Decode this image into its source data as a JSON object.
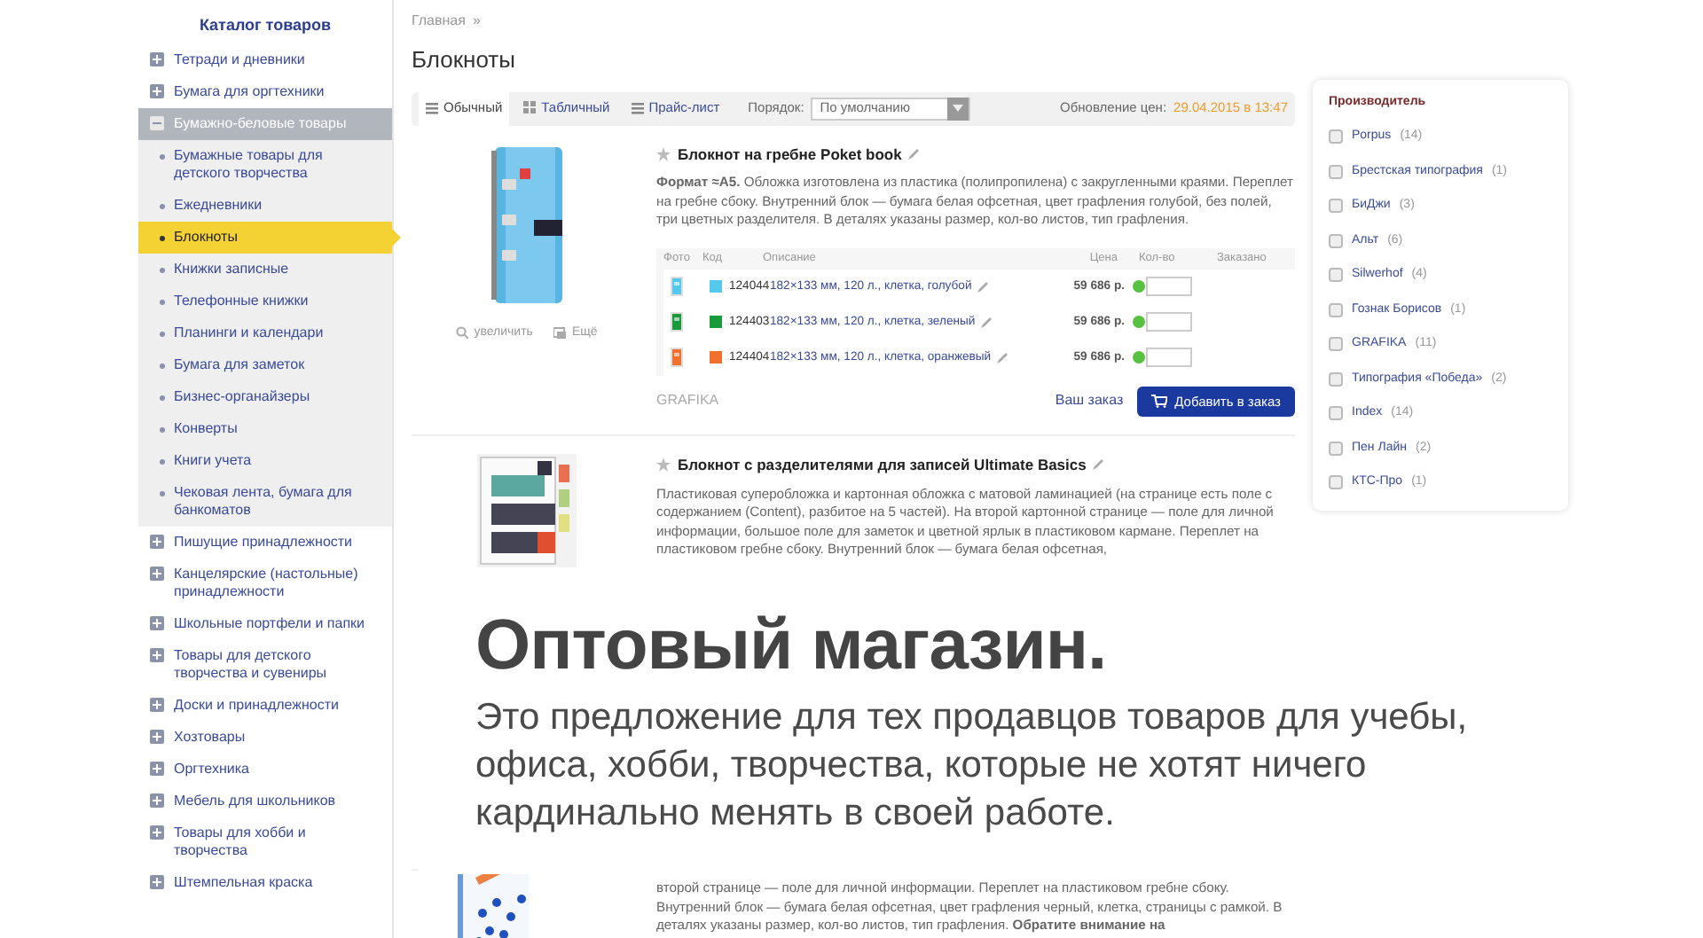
{
  "sidebar": {
    "title": "Каталог товаров",
    "items": [
      {
        "label": "Тетради и дневники",
        "expanded": false
      },
      {
        "label": "Бумага для оргтехники",
        "expanded": false
      },
      {
        "label": "Бумажно-беловые товары",
        "expanded": true,
        "children": [
          {
            "label": "Бумажные товары для детского творчества",
            "selected": false
          },
          {
            "label": "Ежедневники",
            "selected": false
          },
          {
            "label": "Блокноты",
            "selected": true
          },
          {
            "label": "Книжки записные",
            "selected": false
          },
          {
            "label": "Телефонные книжки",
            "selected": false
          },
          {
            "label": "Планинги и календари",
            "selected": false
          },
          {
            "label": "Бумага для заметок",
            "selected": false
          },
          {
            "label": "Бизнес-органайзеры",
            "selected": false
          },
          {
            "label": "Конверты",
            "selected": false
          },
          {
            "label": "Книги учета",
            "selected": false
          },
          {
            "label": "Чековая лента, бумага для банкоматов",
            "selected": false
          }
        ]
      },
      {
        "label": "Пишущие принадлежности",
        "expanded": false
      },
      {
        "label": "Канцелярские (настольные) принадлежности",
        "expanded": false
      },
      {
        "label": "Школьные портфели и папки",
        "expanded": false
      },
      {
        "label": "Товары для детского творчества и сувениры",
        "expanded": false
      },
      {
        "label": "Доски и принадлежности",
        "expanded": false
      },
      {
        "label": "Хозтовары",
        "expanded": false
      },
      {
        "label": "Оргтехника",
        "expanded": false
      },
      {
        "label": "Мебель для школьников",
        "expanded": false
      },
      {
        "label": "Товары для хобби и творчества",
        "expanded": false
      },
      {
        "label": "Штемпельная краска",
        "expanded": false
      }
    ]
  },
  "breadcrumb": [
    {
      "label": "Главная"
    },
    {
      "label": "»"
    }
  ],
  "page_title": "Блокноты",
  "toolbar": {
    "views": [
      {
        "label": "Обычный",
        "selected": true
      },
      {
        "label": "Табличный",
        "selected": false
      },
      {
        "label": "Прайс-лист",
        "selected": false
      }
    ],
    "sort_label": "Порядок:",
    "sort_value": "По умолчанию",
    "update_label": "Обновление цен:",
    "update_value": "29.04.2015 в 13:47"
  },
  "products": [
    {
      "title": "Блокнот на гребне Poket book",
      "description": "**Формат ≈А5.** Обложка изготовлена из пластика (полипропилена) с закругленными краями. Переплет на гребне сбоку. Внутренний блок — бумага белая офсетная, цвет графления голубой, без полей, три цветных разделителя. В деталях указаны размер, кол-во листов, тип графления.",
      "image_links": [
        "увеличить",
        "Ещё"
      ],
      "variants_columns": [
        "Фото",
        "Код",
        "Описание",
        "Цена",
        "Кол-во",
        "Заказано"
      ],
      "variants": [
        {
          "color": "#55c8ee",
          "code": "124044",
          "description": "182×133 мм, 120 л., клетка, голубой",
          "price": "59 686 р.",
          "in_stock": true
        },
        {
          "color": "#1a9a3a",
          "code": "124403",
          "description": "182×133 мм, 120 л., клетка, зеленый",
          "price": "59 686 р.",
          "in_stock": true
        },
        {
          "color": "#f07030",
          "code": "124404",
          "description": "182×133 мм, 120 л., клетка, оранжевый",
          "price": "59 686 р.",
          "in_stock": true
        }
      ],
      "brand": "GRAFIKA",
      "order_link": "Ваш заказ",
      "add_button": "Добавить в заказ"
    },
    {
      "title": "Блокнот с разделителями для записей Ultimate Basics",
      "description": "Пластиковая суперобложка и картонная обложка с матовой ламинацией (на странице есть поле с содержанием (Content), разбитое на 5 частей). На второй картонной странице — поле для личной информации, большое поле для заметок и цветной ярлык в пластиковом кармане. Переплет на пластиковом гребне сбоку. Внутренний блок — бумага белая офсетная,"
    },
    {
      "description": "второй странице — поле для личной информации. Переплет на пластиковом гребне сбоку. Внутренний блок — бумага белая офсетная, цвет графления черный, клетка, страницы с рамкой. В деталях указаны размер, кол-во листов, тип графления. **Обратите внимание на**"
    }
  ],
  "filter": {
    "title": "Производитель",
    "items": [
      {
        "name": "Porpus",
        "count": "(14)",
        "checked": false
      },
      {
        "name": "Брестская типография",
        "count": "(1)",
        "checked": false
      },
      {
        "name": "БиДжи",
        "count": "(3)",
        "checked": false
      },
      {
        "name": "Альт",
        "count": "(6)",
        "checked": false
      },
      {
        "name": "Silwerhof",
        "count": "(4)",
        "checked": false
      },
      {
        "name": "Гознак Борисов",
        "count": "(1)",
        "checked": false
      },
      {
        "name": "GRAFIKA",
        "count": "(11)",
        "checked": false
      },
      {
        "name": "Типография «Победа»",
        "count": "(2)",
        "checked": false
      },
      {
        "name": "Index",
        "count": "(14)",
        "checked": false
      },
      {
        "name": "Пен Лайн",
        "count": "(2)",
        "checked": false
      },
      {
        "name": "КТС-Про",
        "count": "(1)",
        "checked": false
      }
    ]
  },
  "banner": {
    "heading": "Оптовый магазин.",
    "text": "Это предложение для тех продавцов товаров для учебы, офиса, хобби, творчества, которые не хотят ничего кардинально менять в своей работе."
  }
}
